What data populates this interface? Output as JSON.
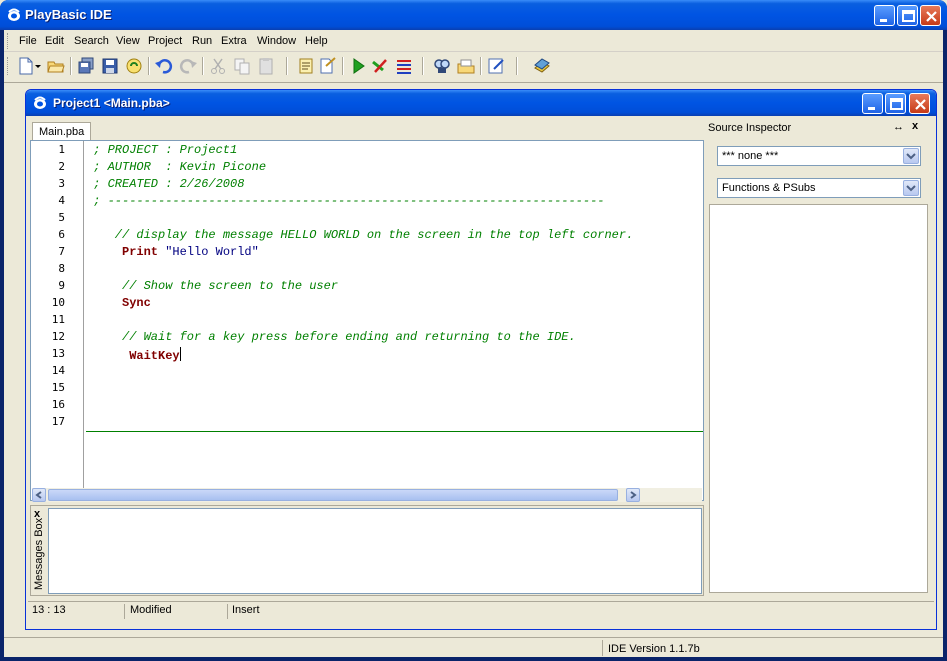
{
  "app": {
    "title": "PlayBasic IDE"
  },
  "menu": {
    "items": [
      "File",
      "Edit",
      "Search",
      "View",
      "Project",
      "Run",
      "Extra",
      "Window",
      "Help"
    ]
  },
  "toolbar": {
    "buttons": [
      "new-file-icon",
      "open-file-icon",
      "save-all-icon",
      "save-icon",
      "open-project-icon",
      "undo-icon",
      "redo-icon",
      "cut-icon",
      "copy-icon",
      "paste-icon",
      "project-properties-icon",
      "compile-icon",
      "run-icon",
      "stop-icon",
      "debug-icon",
      "find-icon",
      "help-icon",
      "notes-icon",
      "documentation-icon"
    ]
  },
  "child": {
    "title": "Project1 <Main.pba>",
    "tab": "Main.pba",
    "lines": [
      {
        "n": "1",
        "text": "; PROJECT : Project1",
        "type": "comment",
        "indent": 1
      },
      {
        "n": "2",
        "text": "; AUTHOR  : Kevin Picone",
        "type": "comment",
        "indent": 1
      },
      {
        "n": "3",
        "text": "; CREATED : 2/26/2008",
        "type": "comment",
        "indent": 1
      },
      {
        "n": "4",
        "text": "; ---------------------------------------------------------------------",
        "type": "comment",
        "indent": 1
      },
      {
        "n": "5",
        "text": "",
        "type": "blank",
        "indent": 0
      },
      {
        "n": "6",
        "text": "// display the message HELLO WORLD on the screen in the top left corner.",
        "type": "comment",
        "indent": 4
      },
      {
        "n": "7",
        "text": "Print",
        "extra": "\"Hello World\"",
        "type": "keyword",
        "indent": 5
      },
      {
        "n": "8",
        "text": "",
        "type": "blank",
        "indent": 0
      },
      {
        "n": "9",
        "text": "// Show the screen to the user",
        "type": "comment",
        "indent": 5
      },
      {
        "n": "10",
        "text": "Sync",
        "type": "keyword",
        "indent": 5
      },
      {
        "n": "11",
        "text": "",
        "type": "blank",
        "indent": 0
      },
      {
        "n": "12",
        "text": "// Wait for a key press before ending and returning to the IDE.",
        "type": "comment",
        "indent": 5
      },
      {
        "n": "13",
        "text": "WaitKey",
        "type": "keyword",
        "indent": 6
      },
      {
        "n": "14",
        "text": "",
        "type": "blank",
        "indent": 0
      },
      {
        "n": "15",
        "text": "",
        "type": "blank",
        "indent": 0
      },
      {
        "n": "16",
        "text": "",
        "type": "blank",
        "indent": 0
      },
      {
        "n": "17",
        "text": "",
        "type": "blank",
        "indent": 0
      }
    ],
    "status": {
      "position": "13 : 13",
      "state": "Modified",
      "mode": "Insert"
    }
  },
  "inspector": {
    "title": "Source Inspector",
    "combo1": "*** none ***",
    "combo2": "Functions & PSubs"
  },
  "messages": {
    "label": "Messages Box"
  },
  "statusbar": {
    "version": "IDE Version 1.1.7b"
  },
  "colors": {
    "comment": "#008000",
    "keyword": "#800000",
    "string": "#000080",
    "titlebar": "#0054e3"
  }
}
